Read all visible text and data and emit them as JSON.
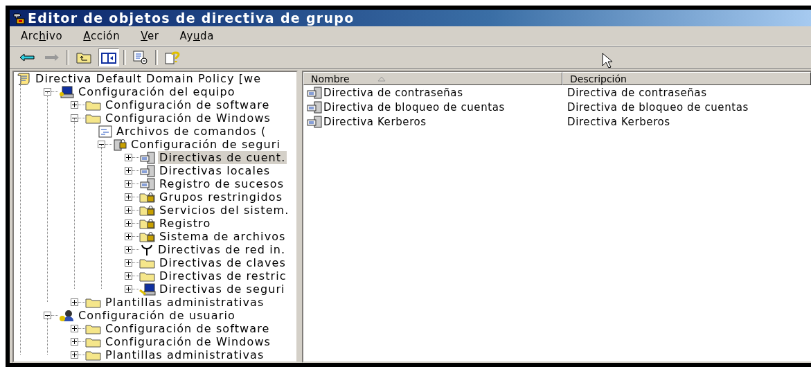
{
  "window": {
    "title": "Editor de objetos de directiva de grupo"
  },
  "menu": [
    {
      "before": "Arc",
      "key": "h",
      "after": "ivo"
    },
    {
      "key": "A",
      "after": "cción"
    },
    {
      "key": "V",
      "after": "er"
    },
    {
      "before": "Ay",
      "key": "u",
      "after": "da"
    }
  ],
  "toolbar_groups": [
    {
      "buttons": [
        {
          "kind": "back",
          "pressed": false
        },
        {
          "kind": "forward",
          "pressed": false
        }
      ]
    },
    {
      "buttons": [
        {
          "kind": "up",
          "pressed": false
        },
        {
          "kind": "tree-toggle",
          "pressed": true
        }
      ]
    },
    {
      "buttons": [
        {
          "kind": "export",
          "pressed": false
        }
      ]
    },
    {
      "buttons": [
        {
          "kind": "help",
          "pressed": false
        }
      ]
    }
  ],
  "tree": [
    {
      "label": "Directiva Default Domain Policy [we",
      "kind": "policy",
      "selected": false,
      "children": [
        {
          "label": "Configuración del equipo",
          "kind": "computer",
          "expanded": true,
          "selected": false,
          "children": [
            {
              "label": "Configuración de software",
              "kind": "folder",
              "expanded": false,
              "selected": false
            },
            {
              "label": "Configuración de Windows",
              "kind": "folder",
              "expanded": true,
              "selected": false,
              "children": [
                {
                  "label": "Archivos de comandos (",
                  "kind": "script",
                  "selected": false
                },
                {
                  "label": "Configuración de seguri",
                  "kind": "security",
                  "expanded": true,
                  "selected": false,
                  "children": [
                    {
                      "label": "Directivas de cuent.",
                      "kind": "server",
                      "expanded": false,
                      "selected": true
                    },
                    {
                      "label": "Directivas locales",
                      "kind": "server",
                      "expanded": false,
                      "selected": false
                    },
                    {
                      "label": "Registro de sucesos",
                      "kind": "server",
                      "expanded": false,
                      "selected": false
                    },
                    {
                      "label": "Grupos restringidos",
                      "kind": "locked-folder",
                      "expanded": false,
                      "selected": false
                    },
                    {
                      "label": "Servicios del sistem.",
                      "kind": "locked-folder",
                      "expanded": false,
                      "selected": false
                    },
                    {
                      "label": "Registro",
                      "kind": "locked-folder",
                      "expanded": false,
                      "selected": false
                    },
                    {
                      "label": "Sistema de archivos",
                      "kind": "locked-folder",
                      "expanded": false,
                      "selected": false
                    },
                    {
                      "label": "Directivas de red in.",
                      "kind": "antenna",
                      "expanded": false,
                      "selected": false
                    },
                    {
                      "label": "Directivas de claves",
                      "kind": "folder",
                      "expanded": false,
                      "selected": false
                    },
                    {
                      "label": "Directivas de restric",
                      "kind": "folder",
                      "expanded": false,
                      "selected": false
                    },
                    {
                      "label": "Directivas de seguri",
                      "kind": "key-computer",
                      "expanded": false,
                      "selected": false
                    }
                  ]
                }
              ]
            },
            {
              "label": "Plantillas administrativas",
              "kind": "folder",
              "expanded": false,
              "selected": false
            }
          ]
        },
        {
          "label": "Configuración de usuario",
          "kind": "user",
          "expanded": true,
          "selected": false,
          "children": [
            {
              "label": "Configuración de software",
              "kind": "folder",
              "expanded": false,
              "selected": false
            },
            {
              "label": "Configuración de Windows",
              "kind": "folder",
              "expanded": false,
              "selected": false
            },
            {
              "label": "Plantillas administrativas",
              "kind": "folder",
              "expanded": false,
              "selected": false
            }
          ]
        }
      ]
    }
  ],
  "list": {
    "columns": [
      {
        "label": "Nombre",
        "sorted": true
      },
      {
        "label": "Descripción",
        "sorted": false
      }
    ],
    "rows": [
      {
        "name": "Directiva de contraseñas",
        "description": "Directiva de contraseñas"
      },
      {
        "name": "Directiva de bloqueo de cuentas",
        "description": "Directiva de bloqueo de cuentas"
      },
      {
        "name": "Directiva Kerberos",
        "description": "Directiva Kerberos"
      }
    ]
  }
}
